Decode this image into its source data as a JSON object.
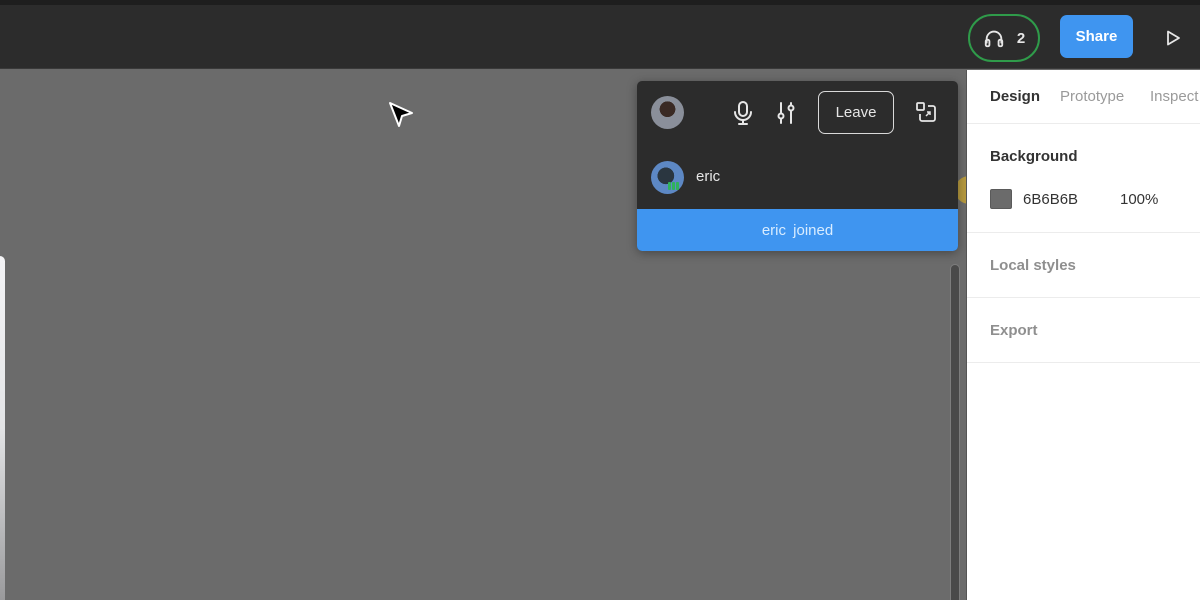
{
  "toolbar": {
    "audio_participants": "2",
    "share_label": "Share",
    "colors": {
      "audio_ring": "#2f9b4a",
      "share_bg": "#3f95f0"
    }
  },
  "call_panel": {
    "leave_label": "Leave",
    "participant_name": "eric",
    "banner_text": "eric joined",
    "colors": {
      "banner_bg": "#3f95f0",
      "speaking": "#2fb35a"
    }
  },
  "right_panel": {
    "tabs": [
      {
        "label": "Design",
        "active": true
      },
      {
        "label": "Prototype",
        "active": false
      },
      {
        "label": "Inspect",
        "active": false
      }
    ],
    "background": {
      "title": "Background",
      "hex": "6B6B6B",
      "opacity": "100%",
      "swatch_color": "#6b6b6b"
    },
    "local_styles_title": "Local styles",
    "export_title": "Export"
  }
}
